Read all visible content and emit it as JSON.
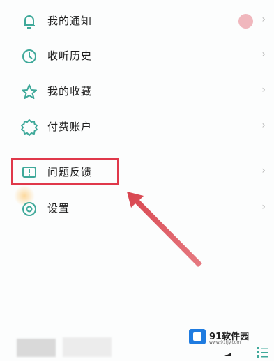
{
  "menu": {
    "items": [
      {
        "label": "我的通知",
        "icon": "bell-icon"
      },
      {
        "label": "收听历史",
        "icon": "clock-icon"
      },
      {
        "label": "我的收藏",
        "icon": "star-icon"
      },
      {
        "label": "付费账户",
        "icon": "badge-icon"
      },
      {
        "label": "问题反馈",
        "icon": "feedback-icon"
      },
      {
        "label": "设置",
        "icon": "settings-icon"
      }
    ],
    "chevron": "›"
  },
  "annotation": {
    "box_color": "#e0384a",
    "arrow_color": "#d8454f"
  },
  "watermark": {
    "text": "91软件园",
    "sub": "www.91rjy.com"
  },
  "colors": {
    "icon_teal": "#3fa99a",
    "badge": "#f0b7bd"
  }
}
